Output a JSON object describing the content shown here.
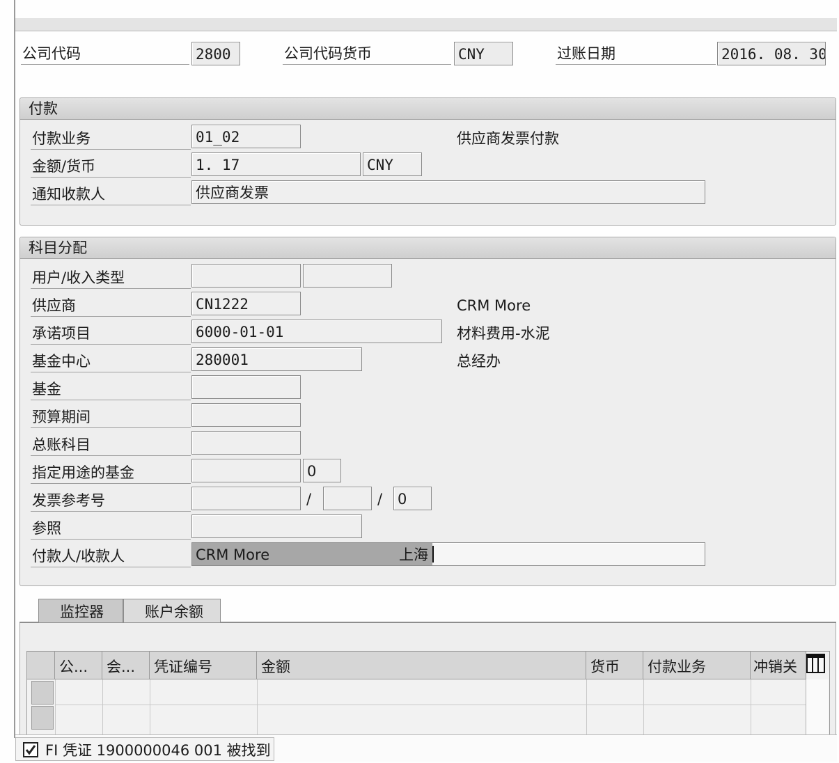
{
  "header": {
    "company_code_label": "公司代码",
    "company_code": "2800",
    "currency_label": "公司代码货币",
    "currency": "CNY",
    "posting_date_label": "过账日期",
    "posting_date": "2016. 08. 30"
  },
  "payment": {
    "title": "付款",
    "transaction_label": "付款业务",
    "transaction": "01_02",
    "transaction_desc": "供应商发票付款",
    "amount_label": "金额/货币",
    "amount": "1. 17",
    "amount_currency": "CNY",
    "notify_label": "通知收款人",
    "notify": "供应商发票"
  },
  "account_assignment": {
    "title": "科目分配",
    "user_type_label": "用户/收入类型",
    "vendor_label": "供应商",
    "vendor": "CN1222",
    "vendor_desc": "CRM More",
    "commitment_label": "承诺项目",
    "commitment": "6000-01-01",
    "commitment_desc": "材料费用-水泥",
    "fund_center_label": "基金中心",
    "fund_center": "280001",
    "fund_center_desc": "总经办",
    "fund_label": "基金",
    "budget_period_label": "预算期间",
    "gl_account_label": "总账科目",
    "earmarked_label": "指定用途的基金",
    "earmarked_item": "0",
    "invoice_ref_label": "发票参考号",
    "invoice_ref_sep1": "/",
    "invoice_ref_sep2": "/",
    "invoice_ref_item": "0",
    "reference_label": "参照",
    "payer_label": "付款人/收款人",
    "payer_name": "CRM More",
    "payer_city": "上海"
  },
  "tabs": [
    {
      "label": "监控器"
    },
    {
      "label": "账户余额"
    }
  ],
  "table": {
    "columns": [
      "公...",
      "会...",
      "凭证编号",
      "金额",
      "货币",
      "付款业务",
      "冲销关"
    ]
  },
  "status": {
    "message": "FI 凭证 1900000046 001 被找到"
  }
}
